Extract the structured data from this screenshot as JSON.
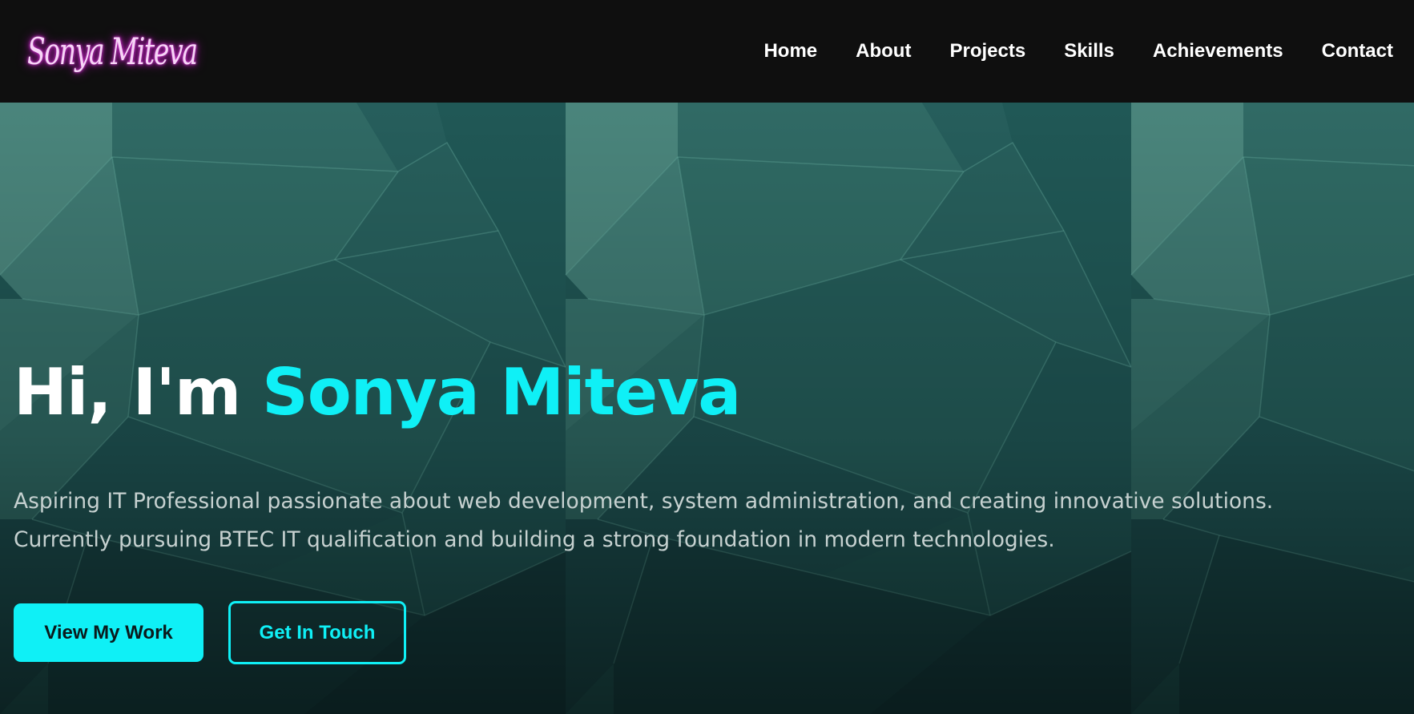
{
  "brand": {
    "logo_text": "Sonya Miteva",
    "logo_color": "#f7d4f7",
    "logo_glow_color": "#d020d0"
  },
  "nav": {
    "items": [
      {
        "label": "Home"
      },
      {
        "label": "About"
      },
      {
        "label": "Projects"
      },
      {
        "label": "Skills"
      },
      {
        "label": "Achievements"
      },
      {
        "label": "Contact"
      }
    ]
  },
  "hero": {
    "title_prefix": "Hi, I'm ",
    "title_name": "Sonya Miteva",
    "description_line1": "Aspiring IT Professional passionate about web development, system administration, and creating innovative solutions.",
    "description_line2": "Currently pursuing BTEC IT qualification and building a strong foundation in modern technologies.",
    "primary_button": "View My Work",
    "secondary_button": "Get In Touch"
  },
  "colors": {
    "navbar_bg": "#0f0f0f",
    "accent": "#0ff0f6",
    "hero_bg": "#1f5553",
    "text_primary": "#ffffff",
    "text_muted": "#c6d1d0"
  }
}
